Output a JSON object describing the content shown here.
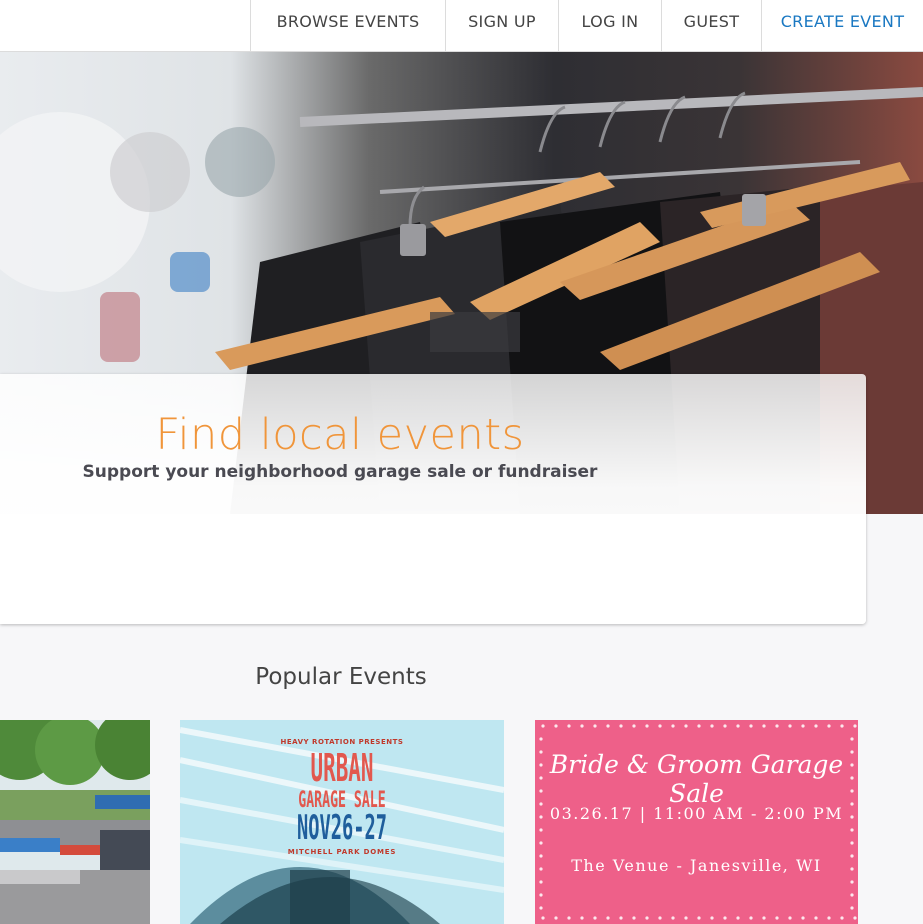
{
  "nav": {
    "items": [
      {
        "label": "BROWSE EVENTS"
      },
      {
        "label": "SIGN UP"
      },
      {
        "label": "LOG IN"
      },
      {
        "label": "GUEST"
      },
      {
        "label": "CREATE EVENT"
      }
    ]
  },
  "hero": {
    "title": "Find local events",
    "subtitle": "Support your neighborhood garage sale or fundraiser"
  },
  "popular": {
    "title": "Popular Events",
    "events": [
      {},
      {
        "poster_top": "HEAVY ROTATION PRESENTS",
        "line1": "URBAN",
        "line2": "GARAGE SALE",
        "line3": "NOV26-27",
        "line4": "MITCHELL PARK DOMES"
      },
      {
        "title": "Bride & Groom Garage Sale",
        "date": "03.26.17 | 11:00 AM - 2:00 PM",
        "venue": "The Venue - Janesville, WI"
      }
    ]
  },
  "colors": {
    "accent": "#1a78c2",
    "title_orange": "#f0953a",
    "pink": "#ee6089"
  }
}
